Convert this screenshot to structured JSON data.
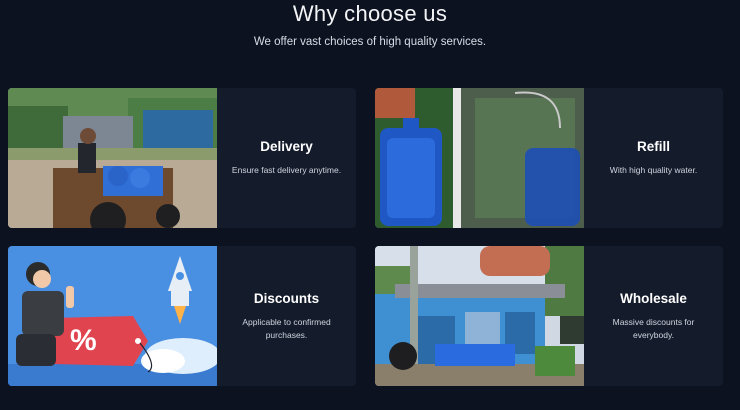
{
  "header": {
    "title": "Why choose us",
    "subtitle": "We offer vast choices of high quality services."
  },
  "cards": [
    {
      "title": "Delivery",
      "description": "Ensure fast delivery anytime.",
      "image_icon": "tricycle-delivery-photo"
    },
    {
      "title": "Refill",
      "description": "With high quality water.",
      "image_icon": "water-gallon-photo"
    },
    {
      "title": "Discounts",
      "description": "Applicable to confirmed purchases.",
      "image_icon": "discount-illustration"
    },
    {
      "title": "Wholesale",
      "description": "Massive discounts for everybody.",
      "image_icon": "storefront-photo"
    }
  ],
  "badge_text": "%",
  "colors": {
    "background": "#0c1220",
    "card": "#141b2b",
    "discount_tag": "#e0444f",
    "illustration_sky": "#4a90e2"
  }
}
